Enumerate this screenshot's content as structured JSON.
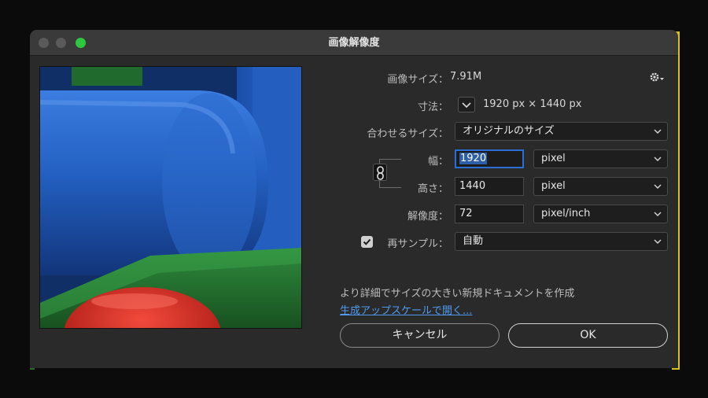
{
  "window": {
    "title": "画像解像度"
  },
  "info": {
    "image_size_label": "画像サイズ：",
    "image_size_value": "7.91M",
    "dimensions_label": "寸法：",
    "dimensions_value": "1920 px × 1440 px",
    "fit_label": "合わせるサイズ：",
    "fit_value": "オリジナルのサイズ"
  },
  "width": {
    "label": "幅：",
    "value": "1920",
    "unit": "pixel"
  },
  "height": {
    "label": "高さ：",
    "value": "1440",
    "unit": "pixel"
  },
  "resolution": {
    "label": "解像度：",
    "value": "72",
    "unit": "pixel/inch"
  },
  "resample": {
    "label": "再サンプル：",
    "checked": true,
    "value": "自動"
  },
  "footer": {
    "info_text": "より詳細でサイズの大きい新規ドキュメントを作成",
    "link_text": "生成アップスケールで開く..."
  },
  "buttons": {
    "cancel": "キャンセル",
    "ok": "OK"
  },
  "icons": {
    "gear": "gear-icon",
    "link": "chain-link-icon",
    "chevron": "chevron-down-icon",
    "check": "checkmark-icon"
  },
  "colors": {
    "accent": "#2a6fd6",
    "link": "#4e9bf0",
    "zoom_green": "#2ec840"
  }
}
